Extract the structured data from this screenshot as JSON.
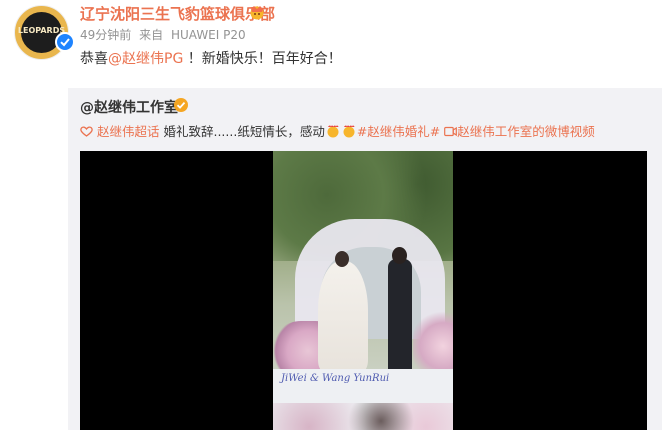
{
  "post": {
    "author": "辽宁沈阳三生飞豹篮球俱乐部",
    "avatar_text": "LEOPARDS",
    "time": "49分钟前",
    "source_prefix": "来自",
    "source": "HUAWEI P20",
    "text_before": "恭喜",
    "mention": "@赵继伟PG",
    "text_after": " ！新婚快乐！百年好合！"
  },
  "repost": {
    "author": "@赵继伟工作室",
    "supertopic": "赵继伟超话",
    "body": " 婚礼致辞......纸短情长，感动",
    "hashtag": "#赵继伟婚礼#",
    "video_link": "赵继伟工作室的微博视频",
    "video_overlay_text": "JiWei & Wang YunRui"
  },
  "colors": {
    "accent": "#eb7350",
    "verified": "#1e84ff",
    "repost_bg": "#f2f2f5"
  }
}
